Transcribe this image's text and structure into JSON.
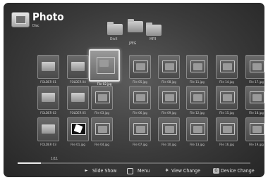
{
  "header": {
    "title": "Photo",
    "subtitle": "Disc"
  },
  "top_folders": [
    {
      "label": "DivX"
    },
    {
      "label": "MP3"
    },
    {
      "label": "JPEG"
    }
  ],
  "grid": [
    {
      "type": "folder",
      "label": "FOLDER 01"
    },
    {
      "type": "folder",
      "label": "FOLDER 04"
    },
    {
      "type": "photo",
      "label": "File 02.jpg",
      "selected": true
    },
    {
      "type": "photo",
      "label": "File 05.jpg"
    },
    {
      "type": "photo",
      "label": "File 08.jpg"
    },
    {
      "type": "photo",
      "label": "File 11.jpg"
    },
    {
      "type": "photo",
      "label": "File 14.jpg"
    },
    {
      "type": "photo",
      "label": "File 17.jpg"
    },
    {
      "type": "folder",
      "label": "FOLDER 02"
    },
    {
      "type": "folder",
      "label": "FOLDER 05"
    },
    {
      "type": "photo",
      "label": "File 03.jpg"
    },
    {
      "type": "photo",
      "label": "File 06.jpg"
    },
    {
      "type": "photo",
      "label": "File 09.jpg"
    },
    {
      "type": "photo",
      "label": "File 12.jpg"
    },
    {
      "type": "photo",
      "label": "File 15.jpg"
    },
    {
      "type": "photo",
      "label": "File 18.jpg"
    },
    {
      "type": "folder",
      "label": "FOLDER 03"
    },
    {
      "type": "photo",
      "label": "File 01.jpg",
      "dark": true
    },
    {
      "type": "photo",
      "label": "File 04.jpg"
    },
    {
      "type": "photo",
      "label": "File 07.jpg"
    },
    {
      "type": "photo",
      "label": "File 10.jpg"
    },
    {
      "type": "photo",
      "label": "File 13.jpg"
    },
    {
      "type": "photo",
      "label": "File 16.jpg"
    },
    {
      "type": "photo",
      "label": "File 19.jpg"
    }
  ],
  "page_indicator": "1/11",
  "progress_fraction": 0.1,
  "help_bar": {
    "slide_show": "Slide Show",
    "menu": "Menu",
    "view_change": "View Change",
    "device_change": "Device Change",
    "slide_show_key": "►",
    "view_change_key": "✱",
    "device_change_key": "G"
  }
}
